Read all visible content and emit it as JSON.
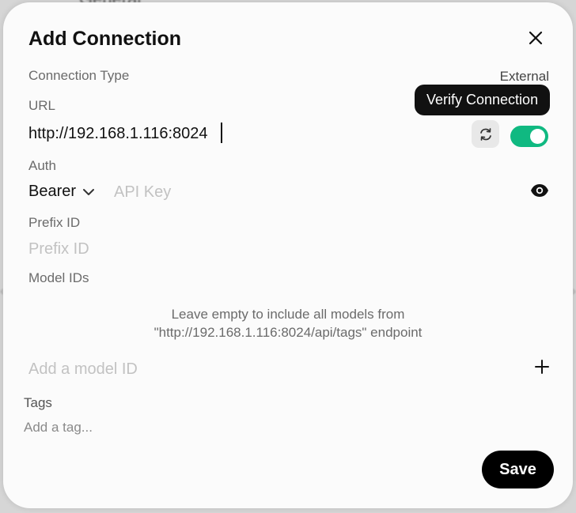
{
  "background": {
    "partial_text": "General"
  },
  "modal": {
    "title": "Add Connection",
    "close_icon": "close-icon",
    "connection_type": {
      "label": "Connection Type",
      "value": "External"
    },
    "url": {
      "label": "URL",
      "value": "http://192.168.1.116:8024",
      "verify_tooltip": "Verify Connection",
      "refresh_icon": "refresh-icon",
      "enabled": true
    },
    "auth": {
      "label": "Auth",
      "selected": "Bearer",
      "api_key_placeholder": "API Key",
      "show_icon": "eye-icon"
    },
    "prefix": {
      "label": "Prefix ID",
      "placeholder": "Prefix ID"
    },
    "model_ids": {
      "label": "Model IDs",
      "hint_line1": "Leave empty to include all models from",
      "hint_line2": "\"http://192.168.1.116:8024/api/tags\" endpoint",
      "placeholder": "Add a model ID",
      "add_icon": "plus-icon"
    },
    "tags": {
      "label": "Tags",
      "placeholder": "Add a tag..."
    },
    "save_label": "Save"
  },
  "colors": {
    "accent": "#10b981",
    "primary_button": "#000000",
    "tooltip_bg": "#111111"
  }
}
